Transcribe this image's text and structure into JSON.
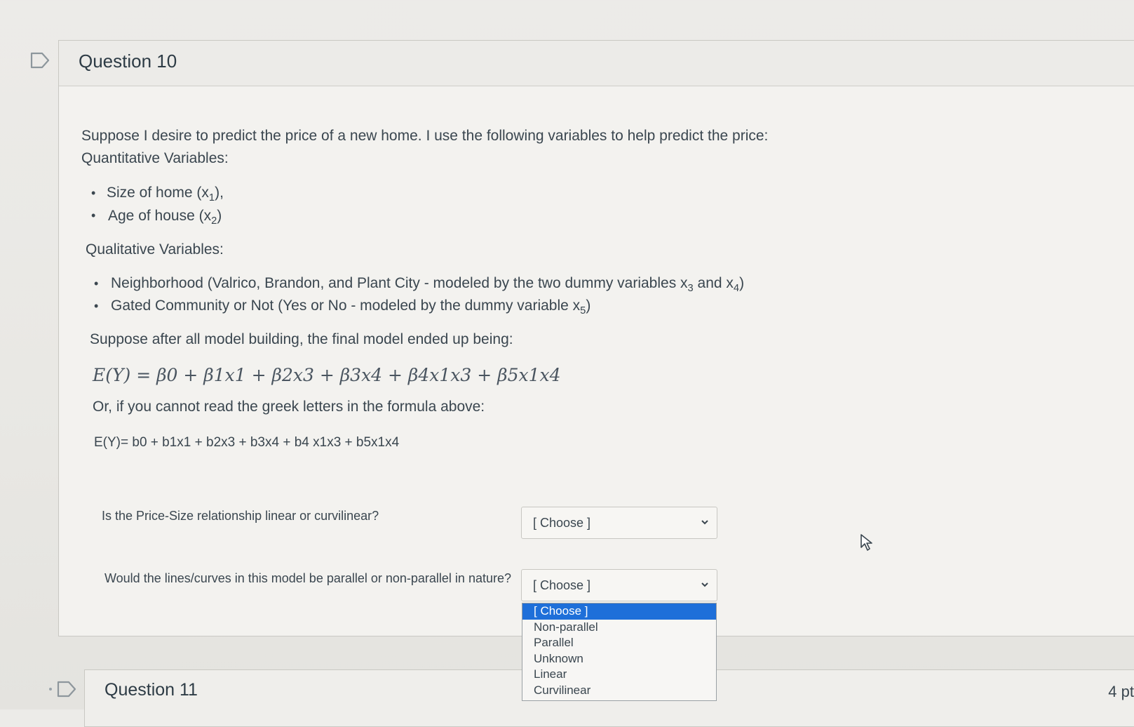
{
  "question10": {
    "title": "Question 10",
    "intro": "Suppose I desire to predict the price of a new home. I use the following variables to help predict the price:",
    "quant_heading": "Quantitative Variables:",
    "quant_items": [
      {
        "text": "Size of home (x",
        "sub": "1",
        "after": "),"
      },
      {
        "text": "Age of house (x",
        "sub": "2",
        "after": ")"
      }
    ],
    "qual_heading": "Qualitative Variables:",
    "qual_items": [
      {
        "text": "Neighborhood (Valrico, Brandon, and Plant City - modeled by the two dummy variables x",
        "sub1": "3",
        "mid": " and x",
        "sub2": "4",
        "after": ")"
      },
      {
        "text": "Gated Community or Not (Yes or No - modeled by the dummy variable x",
        "sub": "5",
        "after": ")"
      }
    ],
    "model_intro": "Suppose after all model building, the final model ended up being:",
    "formula_greek": "E(Y) = β0 + β1x1 + β2x3 + β3x4 + β4x1x3 + β5x1x4",
    "alt_intro": "Or, if you cannot read the greek letters in the formula above:",
    "formula_plain": "E(Y)= b0 + b1x1 + b2x3 + b3x4 + b4 x1x3 + b5x1x4",
    "q_linear": {
      "label": "Is the Price-Size relationship linear or curvilinear?",
      "value": "[ Choose ]"
    },
    "q_parallel": {
      "label": "Would the lines/curves in this model be parallel or non-parallel in nature?",
      "value": "[ Choose ]"
    },
    "dropdown_options": [
      "[ Choose ]",
      "Non-parallel",
      "Parallel",
      "Unknown",
      "Linear",
      "Curvilinear"
    ]
  },
  "question11": {
    "title": "Question 11",
    "points": "4 pt"
  },
  "colors": {
    "selected_option": "#1e6fd9",
    "text": "#3a464f"
  }
}
